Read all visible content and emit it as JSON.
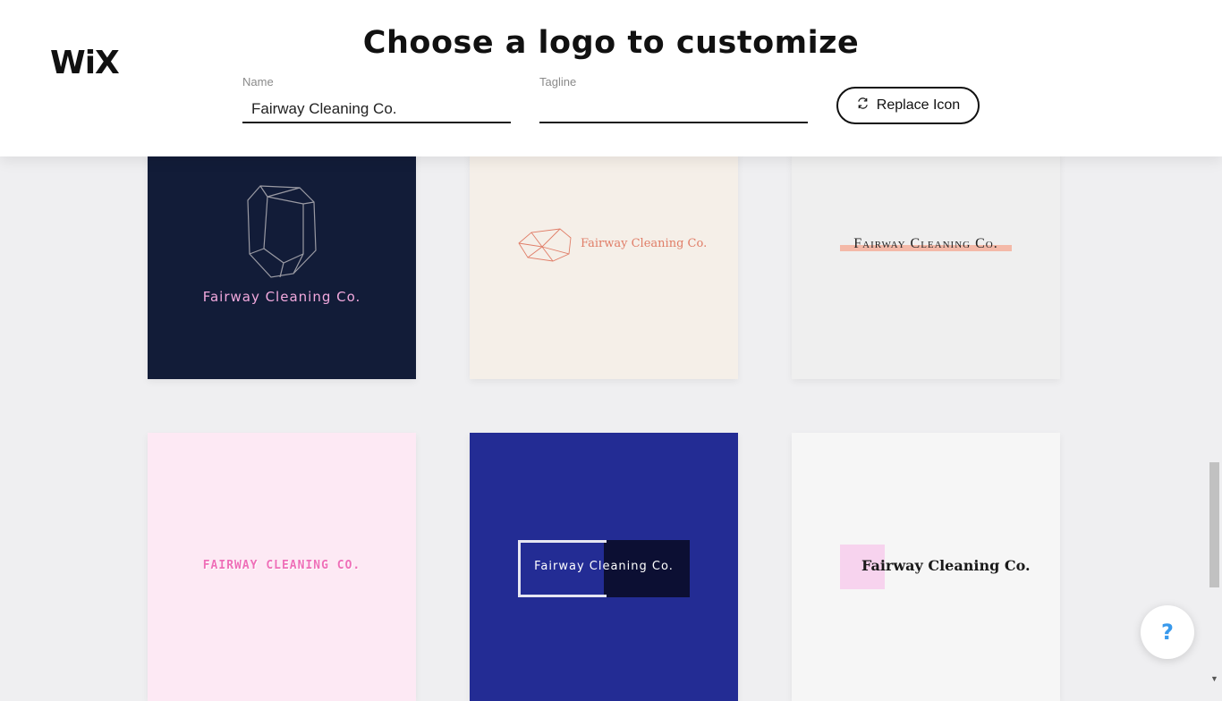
{
  "header": {
    "brand": "WiX",
    "title": "Choose a logo to customize",
    "name_label": "Name",
    "name_value": "Fairway Cleaning Co.",
    "tagline_label": "Tagline",
    "tagline_value": "",
    "replace_label": "Replace Icon"
  },
  "logos": [
    {
      "text": "Fairway Cleaning Co.",
      "bg": "#121c38",
      "text_color": "#f2a9dd",
      "icon": "gem-icon"
    },
    {
      "text": "Fairway Cleaning Co.",
      "bg": "#f5efe8",
      "text_color": "#e07d67",
      "icon": "gem-icon"
    },
    {
      "text": "Fairway Cleaning Co.",
      "bg": "#efefef",
      "text_color": "#222222",
      "accent": "#f4b9a8"
    },
    {
      "text": "FAIRWAY CLEANING CO.",
      "bg": "#fde9f4",
      "text_color": "#ef6fb8"
    },
    {
      "text": "Fairway Cleaning Co.",
      "bg": "#232c94",
      "text_color": "#ffffff",
      "accent": "#0c0f33"
    },
    {
      "text": "Fairway Cleaning Co.",
      "bg": "#f6f6f6",
      "text_color": "#1a1a1a",
      "accent": "#f7d3ee"
    }
  ],
  "help": {
    "label": "?"
  },
  "colors": {
    "accent_blue": "#3899ec"
  }
}
